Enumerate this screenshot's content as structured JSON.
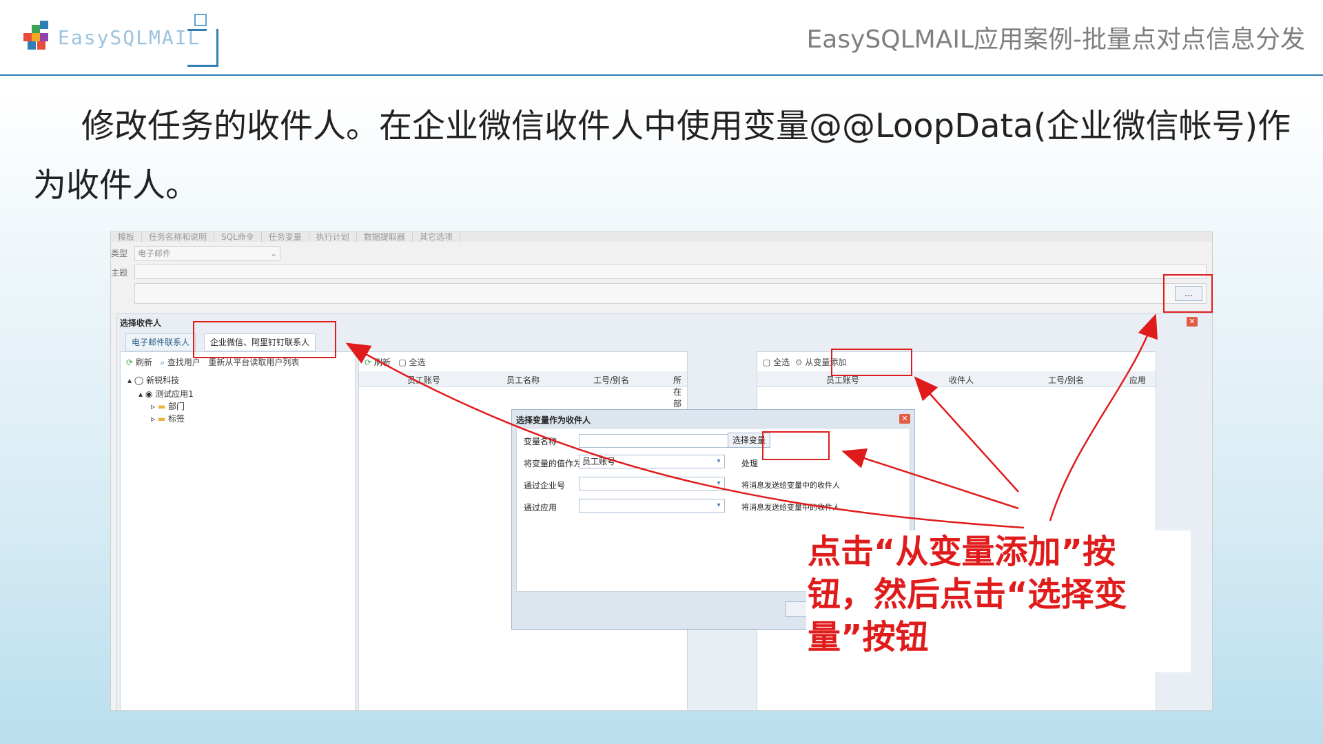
{
  "header": {
    "logo_text": "EasySQLMAIL",
    "title": "EasySQLMAIL应用案例-批量点对点信息分发"
  },
  "main_text": "修改任务的收件人。在企业微信收件人中使用变量@@LoopData(企业微信帐号)作为收件人。",
  "app": {
    "top_tabs": [
      "模板",
      "任务名称和说明",
      "SQL命令",
      "任务变量",
      "执行计划",
      "数据提取器",
      "其它选项"
    ],
    "type_label": "类型",
    "type_value": "电子邮件",
    "subject_label": "主题",
    "ellipsis_button": "...",
    "select_recipient_dialog": {
      "title": "选择收件人",
      "tabs": [
        "电子邮件联系人",
        "企业微信、阿里钉钉联系人"
      ],
      "left_toolbar": {
        "refresh": "刷新",
        "find_user": "查找用户",
        "reload": "重新从平台读取用户列表"
      },
      "tree": {
        "root": "新锐科技",
        "app": "测试应用1",
        "children": [
          "部门",
          "标签"
        ]
      },
      "middle_toolbar": {
        "refresh": "刷新",
        "select_all": "全选"
      },
      "middle_columns": [
        "员工账号",
        "员工名称",
        "工号/别名",
        "所在部门"
      ],
      "right_toolbar": {
        "select_all": "全选",
        "add_from_variable": "从变量添加"
      },
      "right_columns": [
        "员工账号",
        "收件人",
        "工号/别名",
        "应用"
      ]
    },
    "variable_dialog": {
      "title": "选择变量作为收件人",
      "variable_name_label": "变量名称",
      "select_variable_button": "选择变量",
      "value_as_label": "将变量的值作为",
      "value_as_selected": "员工账号",
      "value_as_suffix": "处理",
      "via_corp_label": "通过企业号",
      "via_corp_hint": "将消息发送给变量中的收件人",
      "via_app_label": "通过应用",
      "via_app_hint": "将消息发送给变量中的收件人"
    }
  },
  "annotation": {
    "text": "点击“从变量添加”按钮，然后点击“选择变量”按钮",
    "color": "#e01b1b"
  }
}
